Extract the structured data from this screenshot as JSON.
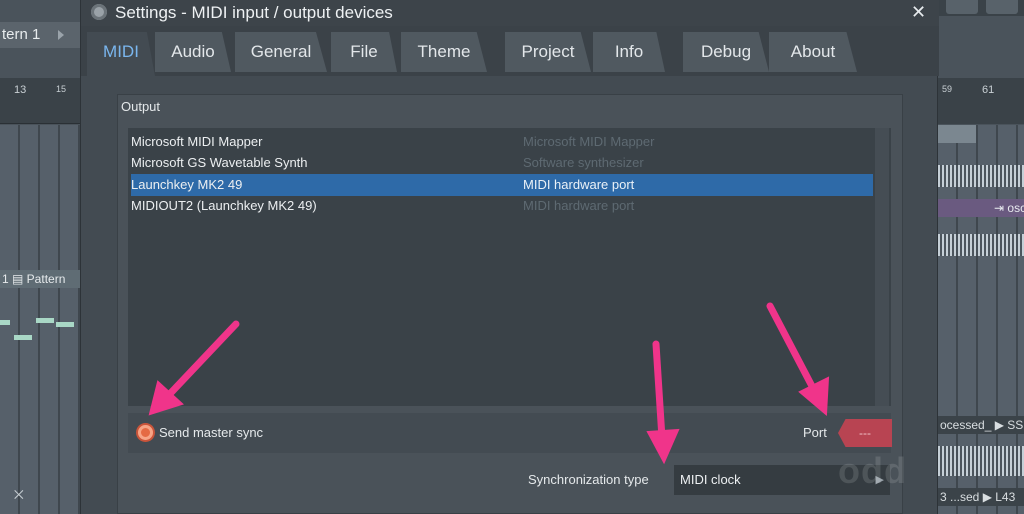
{
  "window": {
    "title": "Settings - MIDI input / output devices",
    "close_glyph": "✕"
  },
  "tabs": [
    {
      "label": "MIDI",
      "active": true
    },
    {
      "label": "Audio"
    },
    {
      "label": "General"
    },
    {
      "label": "File"
    },
    {
      "label": "Theme"
    },
    {
      "label": "Project"
    },
    {
      "label": "Info"
    },
    {
      "label": "Debug"
    },
    {
      "label": "About"
    }
  ],
  "output": {
    "legend": "Output",
    "devices": [
      {
        "name": "Microsoft MIDI Mapper",
        "type": "Microsoft MIDI Mapper",
        "selected": false
      },
      {
        "name": "Microsoft GS Wavetable Synth",
        "type": "Software synthesizer",
        "selected": false
      },
      {
        "name": "Launchkey MK2 49",
        "type": "MIDI hardware port",
        "selected": true
      },
      {
        "name": "MIDIOUT2 (Launchkey MK2 49)",
        "type": "MIDI hardware port",
        "selected": false
      }
    ],
    "send_master_sync_label": "Send master sync",
    "port_label": "Port",
    "port_value": "---",
    "sync_type_label": "Synchronization type",
    "sync_type_value": "MIDI clock"
  },
  "background": {
    "left_pattern_title": "tern 1",
    "left_ruler": [
      "13",
      "15"
    ],
    "left_clip_label": "1 ▤ Pattern",
    "right_ruler": [
      "59",
      "61"
    ],
    "right_clip_label": "⇥ osc",
    "right_label_1": "ocessed_ ▶ SSE",
    "right_label_2": "3 ...sed ▶ L43",
    "left_x": "⨉",
    "watermark": "odd"
  },
  "colors": {
    "accent_tab": "#7ab6ee",
    "selection": "#2e6aa8",
    "port_button": "#b84452",
    "annotation_arrow": "#f0348a"
  }
}
